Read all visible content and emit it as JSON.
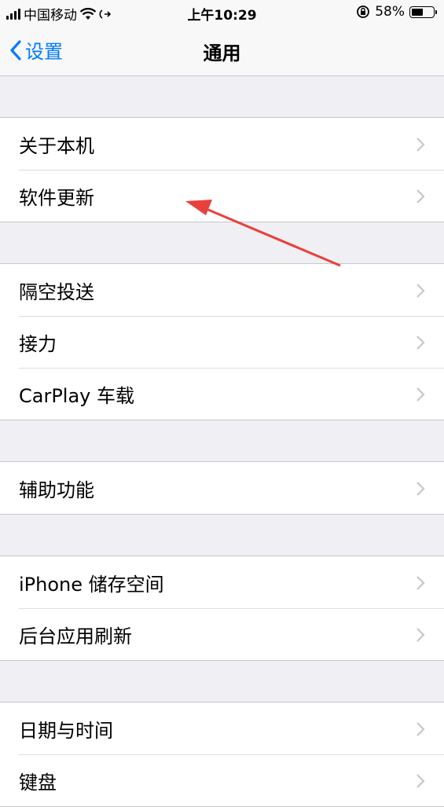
{
  "status_bar": {
    "carrier": "中国移动",
    "time": "上午10:29",
    "battery_text": "58%",
    "battery_level": 0.58
  },
  "nav": {
    "back_label": "设置",
    "title": "通用"
  },
  "groups": [
    {
      "items": [
        {
          "label": "关于本机"
        },
        {
          "label": "软件更新"
        }
      ]
    },
    {
      "items": [
        {
          "label": "隔空投送"
        },
        {
          "label": "接力"
        },
        {
          "label": "CarPlay 车载"
        }
      ]
    },
    {
      "items": [
        {
          "label": "辅助功能"
        }
      ]
    },
    {
      "items": [
        {
          "label": "iPhone 储存空间"
        },
        {
          "label": "后台应用刷新"
        }
      ]
    },
    {
      "items": [
        {
          "label": "日期与时间"
        },
        {
          "label": "键盘"
        }
      ]
    }
  ],
  "colors": {
    "accent": "#007aff",
    "annotation_arrow": "#e8413c",
    "background": "#efeff4"
  }
}
